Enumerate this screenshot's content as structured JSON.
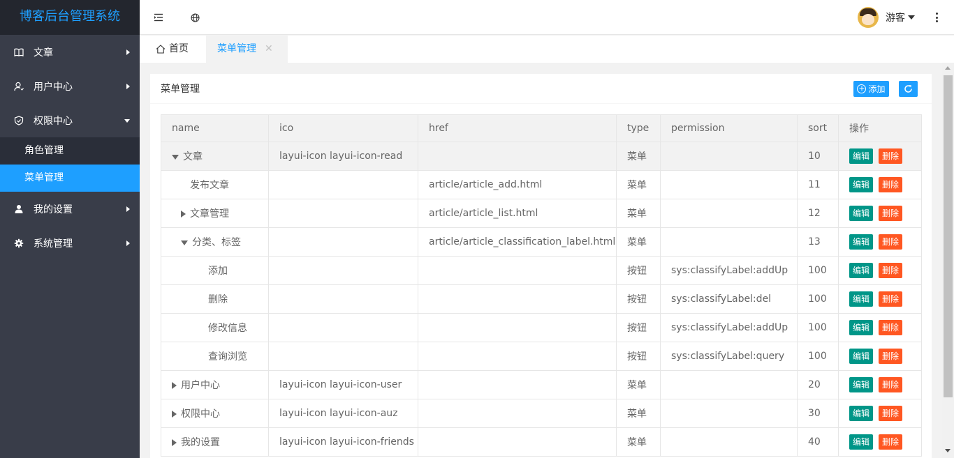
{
  "app": {
    "title": "博客后台管理系统"
  },
  "sidebar": {
    "items": [
      {
        "label": "文章",
        "icon": "book-icon"
      },
      {
        "label": "用户中心",
        "icon": "user-icon"
      },
      {
        "label": "权限中心",
        "icon": "shield-icon",
        "expanded": true,
        "children": [
          {
            "label": "角色管理"
          },
          {
            "label": "菜单管理",
            "active": true
          }
        ]
      },
      {
        "label": "我的设置",
        "icon": "person-icon"
      },
      {
        "label": "系统管理",
        "icon": "gear-icon"
      }
    ]
  },
  "header": {
    "user_name": "游客"
  },
  "tabs": [
    {
      "label": "首页",
      "icon": "home-icon"
    },
    {
      "label": "菜单管理",
      "active": true,
      "close": "✕"
    }
  ],
  "panel": {
    "title": "菜单管理",
    "add_label": "添加"
  },
  "table": {
    "columns": [
      "name",
      "ico",
      "href",
      "type",
      "permission",
      "sort",
      "操作"
    ],
    "edit_label": "编辑",
    "delete_label": "删除",
    "rows": [
      {
        "name": "文章",
        "ico": "layui-icon layui-icon-read",
        "href": "",
        "type": "菜单",
        "permission": "",
        "sort": "10"
      },
      {
        "name": "发布文章",
        "ico": "",
        "href": "article/article_add.html",
        "type": "菜单",
        "permission": "",
        "sort": "11"
      },
      {
        "name": "文章管理",
        "ico": "",
        "href": "article/article_list.html",
        "type": "菜单",
        "permission": "",
        "sort": "12"
      },
      {
        "name": "分类、标签",
        "ico": "",
        "href": "article/article_classification_label.html",
        "type": "菜单",
        "permission": "",
        "sort": "13"
      },
      {
        "name": "添加",
        "ico": "",
        "href": "",
        "type": "按钮",
        "permission": "sys:classifyLabel:addUp",
        "sort": "100"
      },
      {
        "name": "删除",
        "ico": "",
        "href": "",
        "type": "按钮",
        "permission": "sys:classifyLabel:del",
        "sort": "100"
      },
      {
        "name": "修改信息",
        "ico": "",
        "href": "",
        "type": "按钮",
        "permission": "sys:classifyLabel:addUp",
        "sort": "100"
      },
      {
        "name": "查询浏览",
        "ico": "",
        "href": "",
        "type": "按钮",
        "permission": "sys:classifyLabel:query",
        "sort": "100"
      },
      {
        "name": "用户中心",
        "ico": "layui-icon layui-icon-user",
        "href": "",
        "type": "菜单",
        "permission": "",
        "sort": "20"
      },
      {
        "name": "权限中心",
        "ico": "layui-icon layui-icon-auz",
        "href": "",
        "type": "菜单",
        "permission": "",
        "sort": "30"
      },
      {
        "name": "我的设置",
        "ico": "layui-icon layui-icon-friends",
        "href": "",
        "type": "菜单",
        "permission": "",
        "sort": "40"
      }
    ]
  },
  "colors": {
    "accent": "#1e9fff",
    "sidebar": "#393d49",
    "edit": "#009688",
    "delete": "#ff5722"
  }
}
